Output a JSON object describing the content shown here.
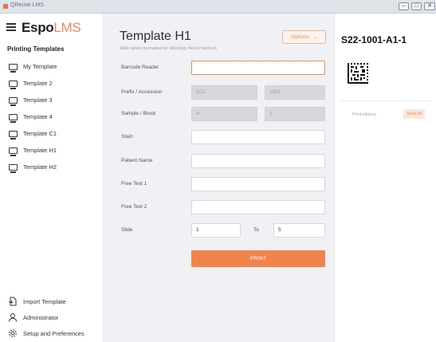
{
  "window": {
    "title": "QReuse LMS",
    "controls": [
      "–",
      "□",
      "✕"
    ]
  },
  "sidebar": {
    "logo_main": "Espo",
    "logo_accent": "LMS",
    "section_title": "Printing Templates",
    "items": [
      {
        "label": "My Template",
        "icon": "label-printer-icon"
      },
      {
        "label": "Template 2",
        "icon": "label-printer-icon"
      },
      {
        "label": "Template 3",
        "icon": "label-printer-icon"
      },
      {
        "label": "Template 4",
        "icon": "label-printer-icon"
      },
      {
        "label": "Template C1",
        "icon": "label-printer-icon"
      },
      {
        "label": "Template H1",
        "icon": "label-printer-icon"
      },
      {
        "label": "Template H2",
        "icon": "label-printer-icon"
      }
    ],
    "footer": [
      {
        "label": "Import Template",
        "icon": "import-file-icon"
      },
      {
        "label": "Administrator",
        "icon": "user-icon"
      },
      {
        "label": "Setup and Preferences",
        "icon": "gear-icon"
      }
    ]
  },
  "main": {
    "title": "Template H1",
    "subtitle": "Slide labels formatted for Histology Best Practices.",
    "options_label": "Options",
    "fields": {
      "barcode_reader": {
        "label": "Barcode Reader",
        "value": ""
      },
      "prefix_accession": {
        "label": "Prefix / Accession",
        "prefix": "S22",
        "accession": "1001"
      },
      "sample_block": {
        "label": "Sample / Block",
        "sample": "A",
        "block": "1"
      },
      "stain": {
        "label": "Stain",
        "value": ""
      },
      "patient_name": {
        "label": "Patient Name",
        "value": ""
      },
      "free_text_1": {
        "label": "Free Text 1",
        "value": ""
      },
      "free_text_2": {
        "label": "Free Text 2",
        "value": ""
      },
      "slide": {
        "label": "Slide",
        "from": "1",
        "to_label": "To",
        "to": "5"
      }
    },
    "print_label": "PRINT"
  },
  "preview": {
    "label_code": "S22-1001-A1-1",
    "print_history_label": "Print History",
    "show_all_label": "Show All"
  },
  "colors": {
    "accent": "#f0844c",
    "panel_bg": "#f0f1f4"
  }
}
